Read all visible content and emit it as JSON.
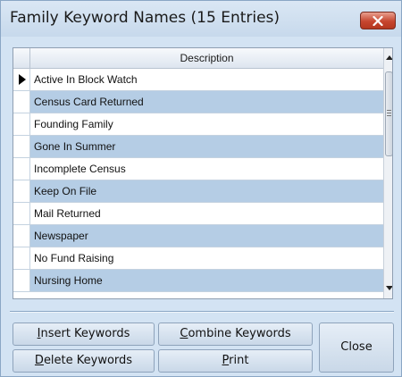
{
  "window": {
    "title": "Family Keyword Names (15 Entries)"
  },
  "grid": {
    "column_header": "Description",
    "rows": [
      "Active In Block Watch",
      "Census Card Returned",
      "Founding Family",
      "Gone In Summer",
      "Incomplete Census",
      "Keep On File",
      "Mail Returned",
      "Newspaper",
      "No Fund Raising",
      "Nursing Home"
    ],
    "current_row_index": 0
  },
  "buttons": {
    "insert": {
      "underline": "I",
      "rest": "nsert Keywords"
    },
    "combine": {
      "underline": "C",
      "rest": "ombine Keywords"
    },
    "delete": {
      "underline": "D",
      "rest": "elete Keywords"
    },
    "print": {
      "underline": "P",
      "rest": "rint"
    },
    "close": "Close"
  },
  "colors": {
    "window_bg": "#d3e3f3",
    "alt_row": "#b5cde5",
    "close_button": "#c6462f"
  }
}
